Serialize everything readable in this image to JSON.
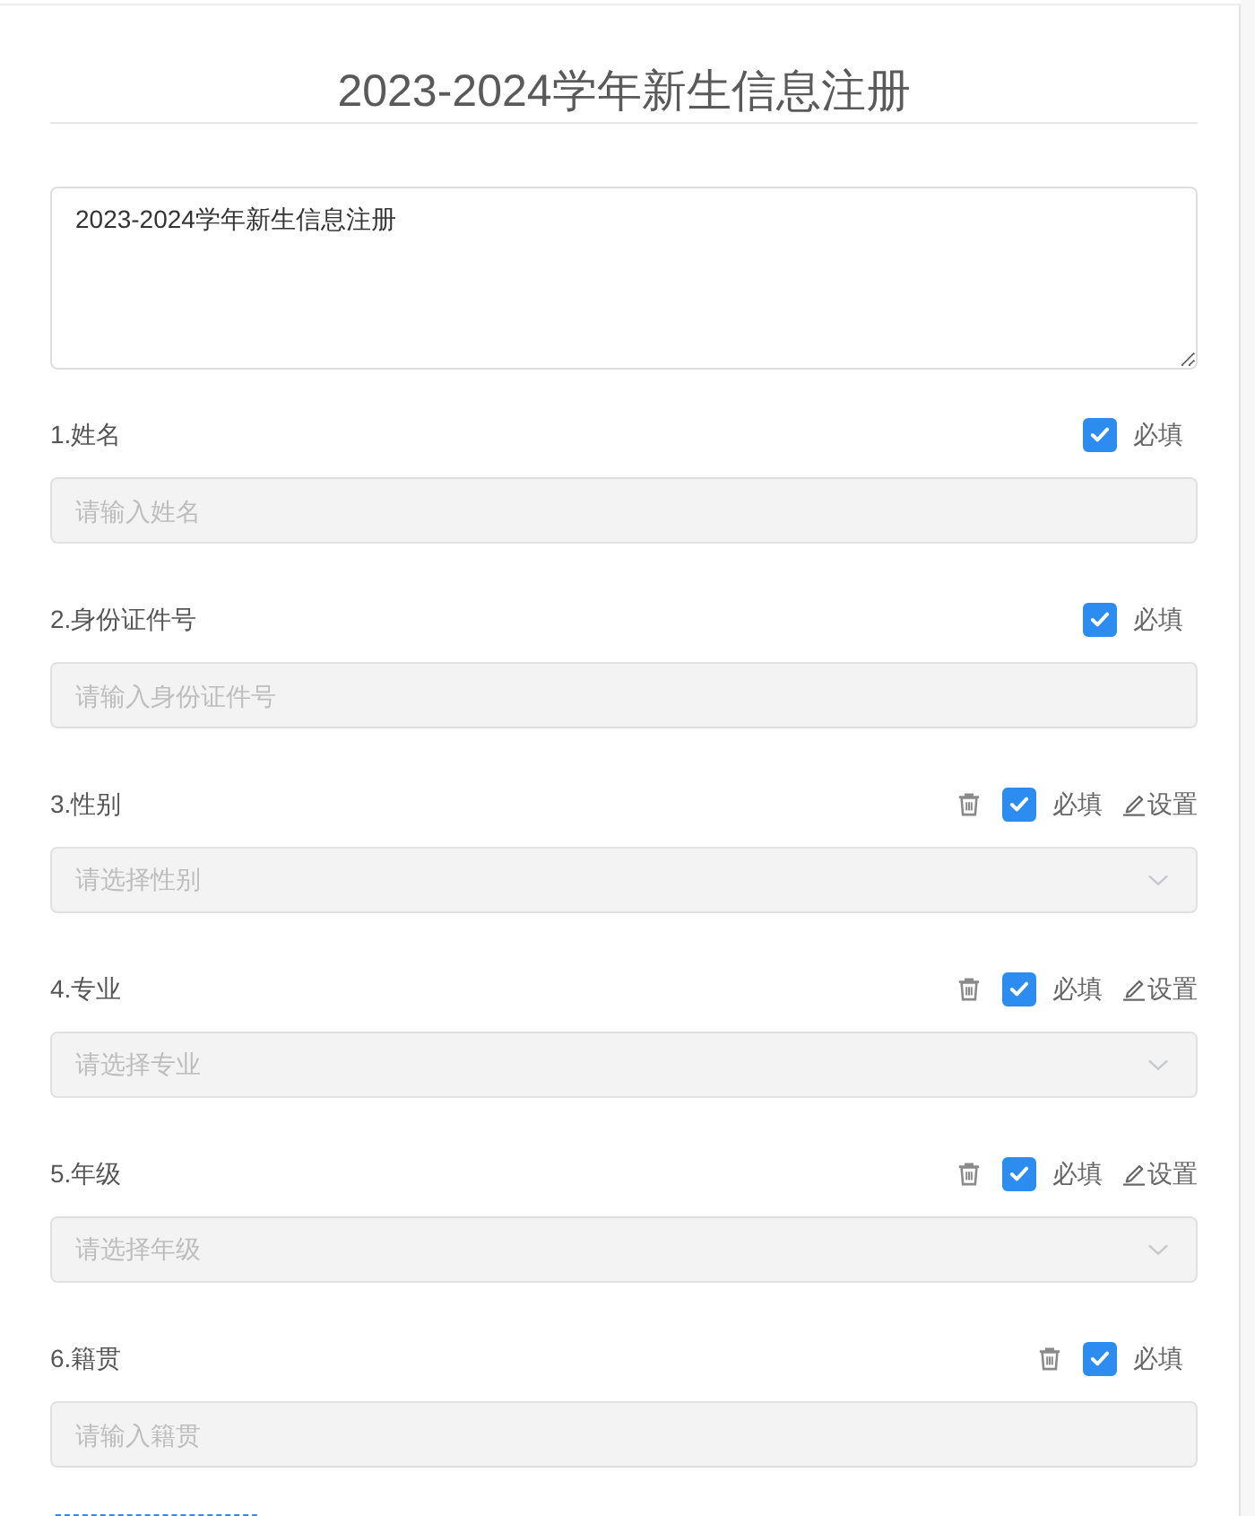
{
  "title": "2023-2024学年新生信息注册",
  "description": {
    "value": "2023-2024学年新生信息注册"
  },
  "questions": [
    {
      "label": "1.姓名",
      "kind": "input",
      "placeholder": "请输入姓名",
      "required": true,
      "required_label": "必填",
      "deletable": false
    },
    {
      "label": "2.身份证件号",
      "kind": "input",
      "placeholder": "请输入身份证件号",
      "required": true,
      "required_label": "必填",
      "deletable": false
    },
    {
      "label": "3.性别",
      "kind": "select",
      "placeholder": "请选择性别",
      "required": true,
      "required_label": "必填",
      "deletable": true,
      "settings_label": "设置"
    },
    {
      "label": "4.专业",
      "kind": "select",
      "placeholder": "请选择专业",
      "required": true,
      "required_label": "必填",
      "deletable": true,
      "settings_label": "设置"
    },
    {
      "label": "5.年级",
      "kind": "select",
      "placeholder": "请选择年级",
      "required": true,
      "required_label": "必填",
      "deletable": true,
      "settings_label": "设置"
    },
    {
      "label": "6.籍贯",
      "kind": "input",
      "placeholder": "请输入籍贯",
      "required": true,
      "required_label": "必填",
      "deletable": true
    }
  ],
  "add_button": {
    "visible": true
  }
}
